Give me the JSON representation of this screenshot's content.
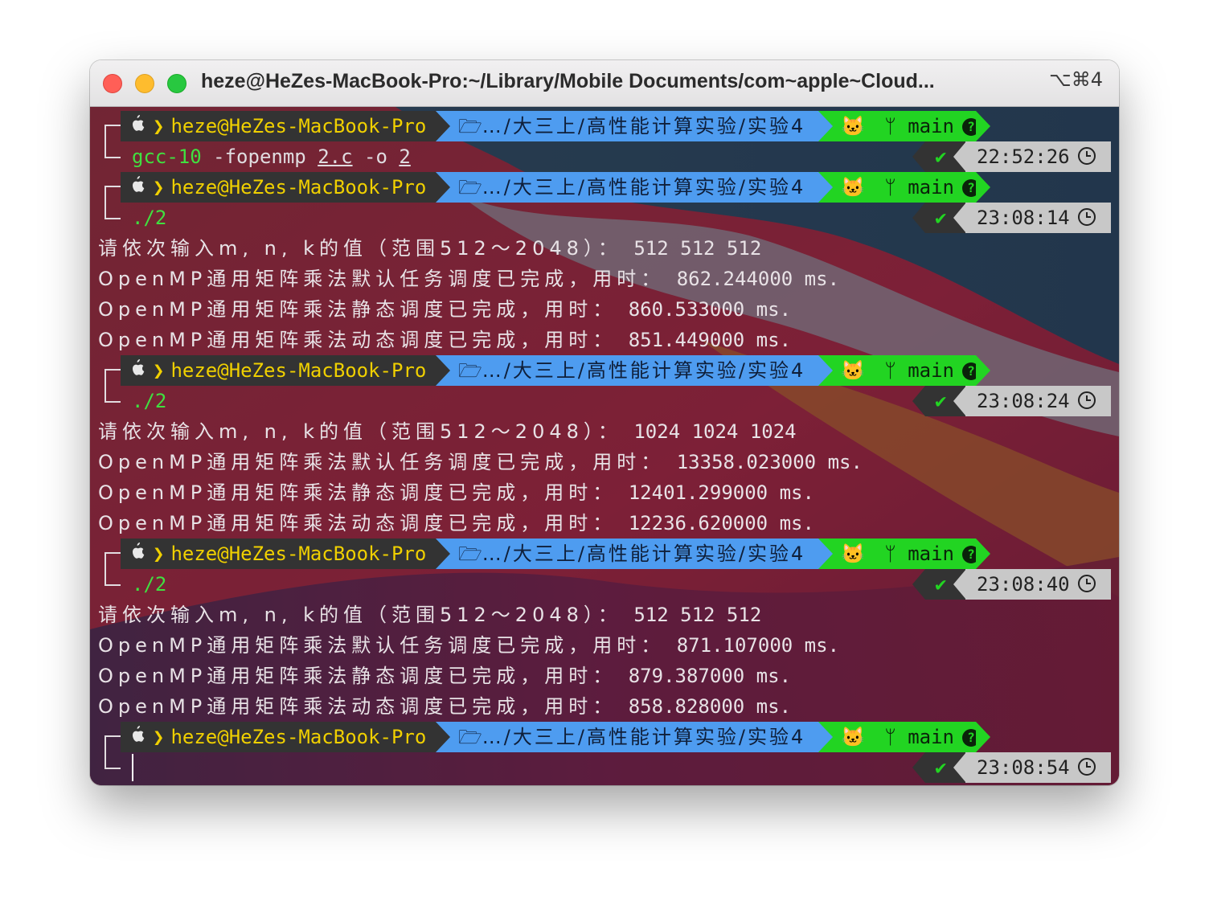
{
  "window": {
    "title": "heze@HeZes-MacBook-Pro:~/Library/Mobile Documents/com~apple~Cloud...",
    "shortcut": "⌥⌘4"
  },
  "prompt": {
    "user": "heze@HeZes-MacBook-Pro",
    "path": "…/大三上/高性能计算实验/实验4",
    "branch": "main"
  },
  "blocks": [
    {
      "time": "22:52:26",
      "command": {
        "prog": "gcc-10",
        "args1": " -fopenmp ",
        "file": "2.c",
        "args2": " -o ",
        "out": "2"
      },
      "output": []
    },
    {
      "time": "23:08:14",
      "command": {
        "run": "./2"
      },
      "output": [
        {
          "label": "请依次输入m, n, k的值（范围512～2048）：",
          "value": " 512 512 512"
        },
        {
          "label": "OpenMP通用矩阵乘法默认任务调度已完成，用时：",
          "value": " 862.244000 ms."
        },
        {
          "label": "OpenMP通用矩阵乘法静态调度已完成，用时：",
          "value": " 860.533000 ms."
        },
        {
          "label": "OpenMP通用矩阵乘法动态调度已完成，用时：",
          "value": " 851.449000 ms."
        }
      ]
    },
    {
      "time": "23:08:24",
      "command": {
        "run": "./2"
      },
      "output": [
        {
          "label": "请依次输入m, n, k的值（范围512～2048）：",
          "value": " 1024 1024 1024"
        },
        {
          "label": "OpenMP通用矩阵乘法默认任务调度已完成，用时：",
          "value": " 13358.023000 ms."
        },
        {
          "label": "OpenMP通用矩阵乘法静态调度已完成，用时：",
          "value": " 12401.299000 ms."
        },
        {
          "label": "OpenMP通用矩阵乘法动态调度已完成，用时：",
          "value": " 12236.620000 ms."
        }
      ]
    },
    {
      "time": "23:08:40",
      "command": {
        "run": "./2"
      },
      "output": [
        {
          "label": "请依次输入m, n, k的值（范围512～2048）：",
          "value": " 512 512 512"
        },
        {
          "label": "OpenMP通用矩阵乘法默认任务调度已完成，用时：",
          "value": " 871.107000 ms."
        },
        {
          "label": "OpenMP通用矩阵乘法静态调度已完成，用时：",
          "value": " 879.387000 ms."
        },
        {
          "label": "OpenMP通用矩阵乘法动态调度已完成，用时：",
          "value": " 858.828000 ms."
        }
      ]
    },
    {
      "time": "23:08:54",
      "command": null,
      "output": []
    }
  ],
  "colors": {
    "user_segment": "#333333",
    "user_text": "#f0d000",
    "path_segment": "#4e9cf0",
    "git_segment": "#22d422",
    "time_segment": "#c8c8c8",
    "command_text": "#40e040"
  },
  "icons": [
    "apple-icon",
    "folder-open-icon",
    "github-icon",
    "branch-icon",
    "question-icon",
    "check-icon",
    "clock-icon"
  ]
}
